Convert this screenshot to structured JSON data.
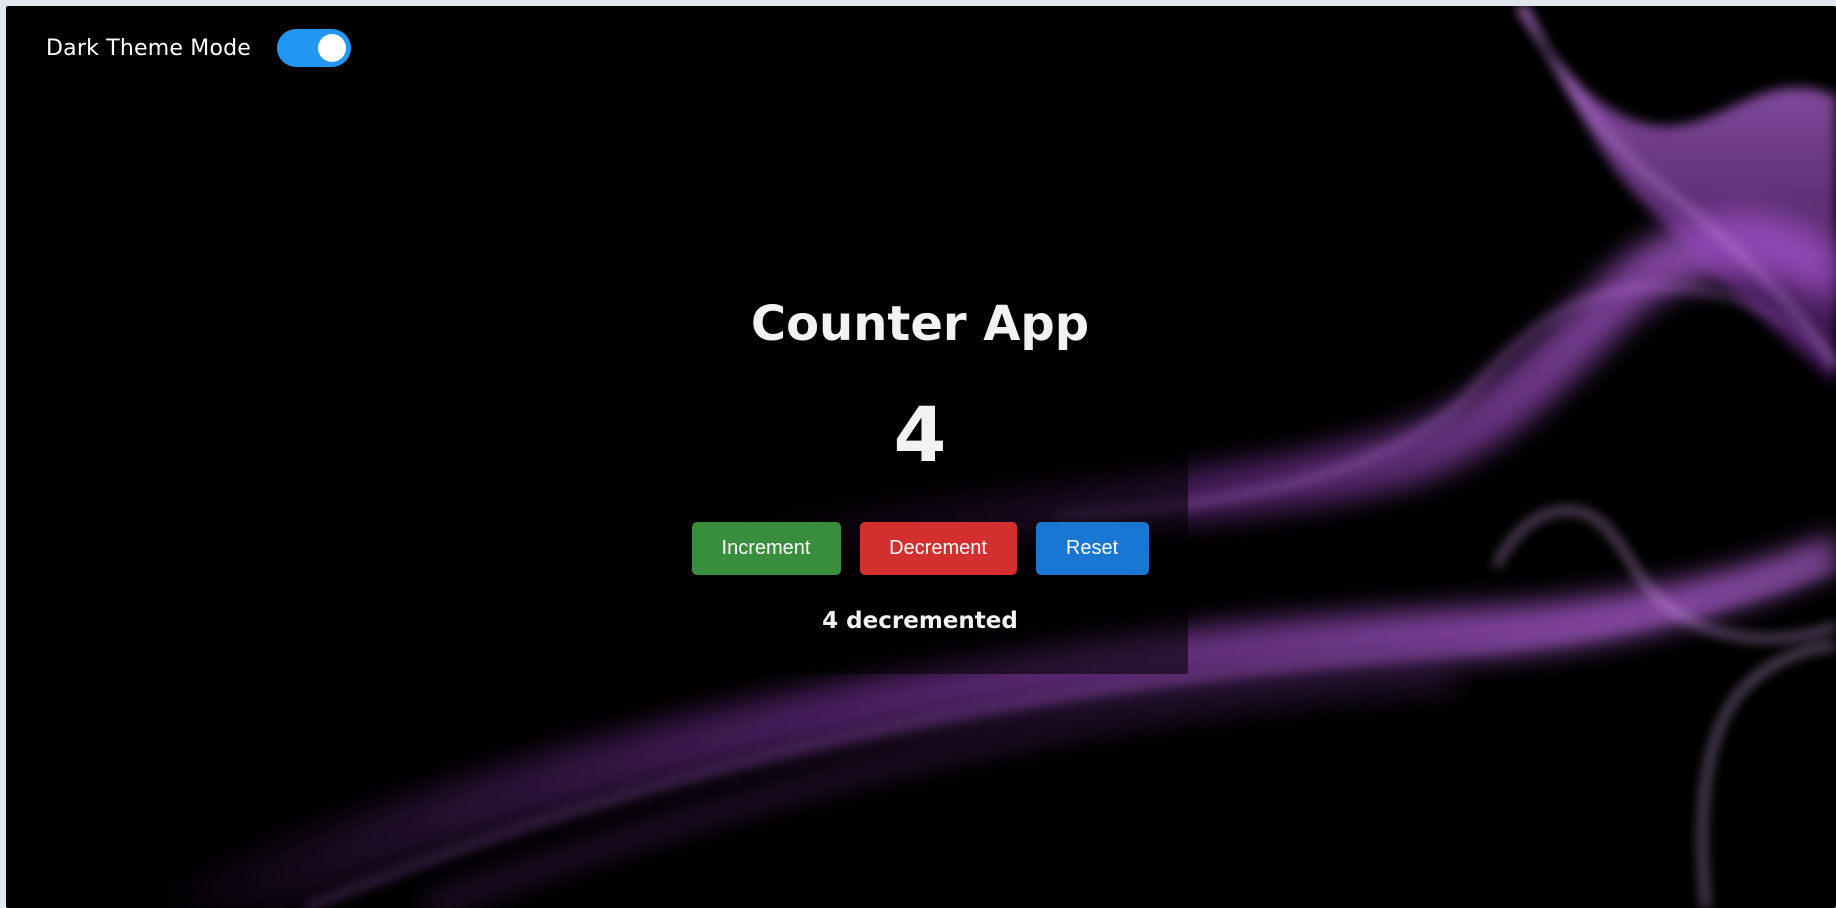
{
  "theme_toggle": {
    "label": "Dark Theme Mode",
    "checked": true,
    "color": "#2196f3"
  },
  "counter": {
    "title": "Counter App",
    "value": "4",
    "status": "4 decremented"
  },
  "buttons": {
    "increment": {
      "label": "Increment",
      "color": "#388e3c"
    },
    "decrement": {
      "label": "Decrement",
      "color": "#d32f2f"
    },
    "reset": {
      "label": "Reset",
      "color": "#1976d2"
    }
  },
  "colors": {
    "background": "#000000",
    "wave_accent": "#b04ce0"
  }
}
